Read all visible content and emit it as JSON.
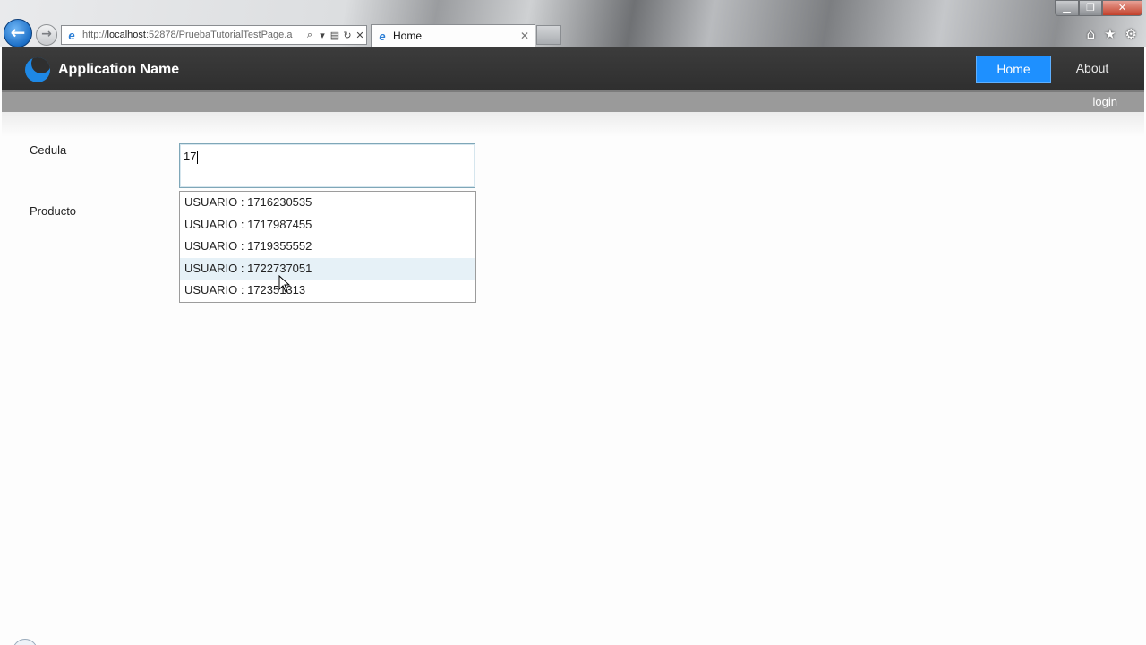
{
  "browser": {
    "address": {
      "prefix": "http://",
      "host": "localhost",
      "rest": ":52878/PruebaTutorialTestPage.a"
    },
    "tab_title": "Home",
    "tab_close": "✕",
    "toolbar_icons": [
      "home-icon",
      "favorites-star-icon",
      "tools-gear-icon"
    ],
    "window_controls": [
      "minimize",
      "maximize",
      "close"
    ]
  },
  "site": {
    "app_name": "Application Name",
    "menu": {
      "home": "Home",
      "about": "About"
    },
    "login": "login"
  },
  "form": {
    "cedula_label": "Cedula",
    "cedula_value": "17",
    "producto_label": "Producto",
    "suggestions": [
      "USUARIO : 1716230535",
      "USUARIO : 1717987455",
      "USUARIO : 1719355552",
      "USUARIO : 1722737051",
      "USUARIO : 172351313"
    ],
    "hovered_suggestion_index": 3
  },
  "colors": {
    "header_bg": "#333333",
    "accent": "#1e90ff",
    "hover_row": "#e6f1f7"
  }
}
